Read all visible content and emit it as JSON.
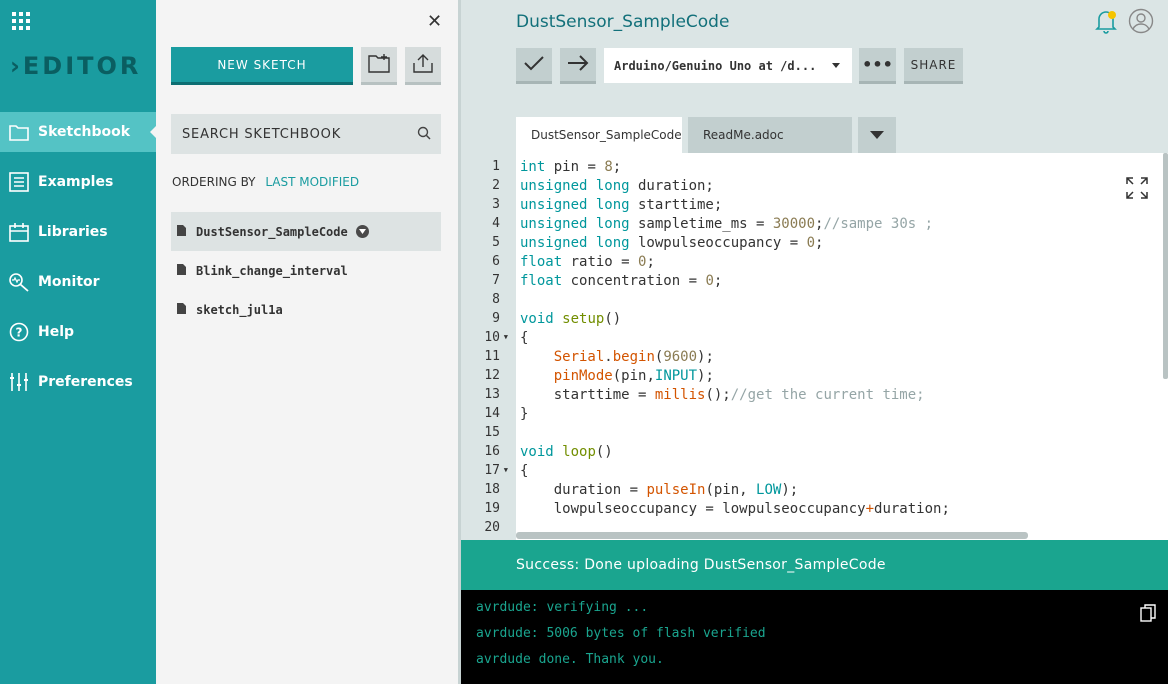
{
  "nav": {
    "logo": "EDITOR",
    "items": [
      {
        "label": "Sketchbook",
        "icon": "folder-icon",
        "active": true
      },
      {
        "label": "Examples",
        "icon": "list-icon",
        "active": false
      },
      {
        "label": "Libraries",
        "icon": "library-icon",
        "active": false
      },
      {
        "label": "Monitor",
        "icon": "monitor-icon",
        "active": false
      },
      {
        "label": "Help",
        "icon": "help-icon",
        "active": false
      },
      {
        "label": "Preferences",
        "icon": "sliders-icon",
        "active": false
      }
    ]
  },
  "sketchbook": {
    "new_sketch_label": "NEW SKETCH",
    "search_placeholder": "SEARCH SKETCHBOOK",
    "ordering_label": "ORDERING BY",
    "ordering_value": "LAST MODIFIED",
    "sketches": [
      {
        "name": "DustSensor_SampleCode",
        "active": true
      },
      {
        "name": "Blink_change_interval",
        "active": false
      },
      {
        "name": "sketch_jul1a",
        "active": false
      }
    ]
  },
  "editor": {
    "sketch_title": "DustSensor_SampleCode",
    "board_label": "Arduino/Genuino Uno at /d...",
    "share_label": "SHARE",
    "tabs": [
      {
        "label": "DustSensor_SampleCode",
        "active": true
      },
      {
        "label": "ReadMe.adoc",
        "active": false
      }
    ],
    "line_numbers": [
      "1",
      "2",
      "3",
      "4",
      "5",
      "6",
      "7",
      "8",
      "9",
      "10",
      "11",
      "12",
      "13",
      "14",
      "15",
      "16",
      "17",
      "18",
      "19",
      "20"
    ],
    "fold_lines": [
      "10",
      "17"
    ]
  },
  "status": {
    "message": "Success: Done uploading DustSensor_SampleCode"
  },
  "console": {
    "lines": [
      "avrdude: verifying ...",
      "avrdude: 5006 bytes of flash verified",
      "avrdude done.  Thank you."
    ]
  },
  "colors": {
    "nav_bg": "#1a9ca0",
    "nav_active": "#54c3c5",
    "status_bg": "#1aa58f",
    "console_text": "#1aa58f"
  }
}
